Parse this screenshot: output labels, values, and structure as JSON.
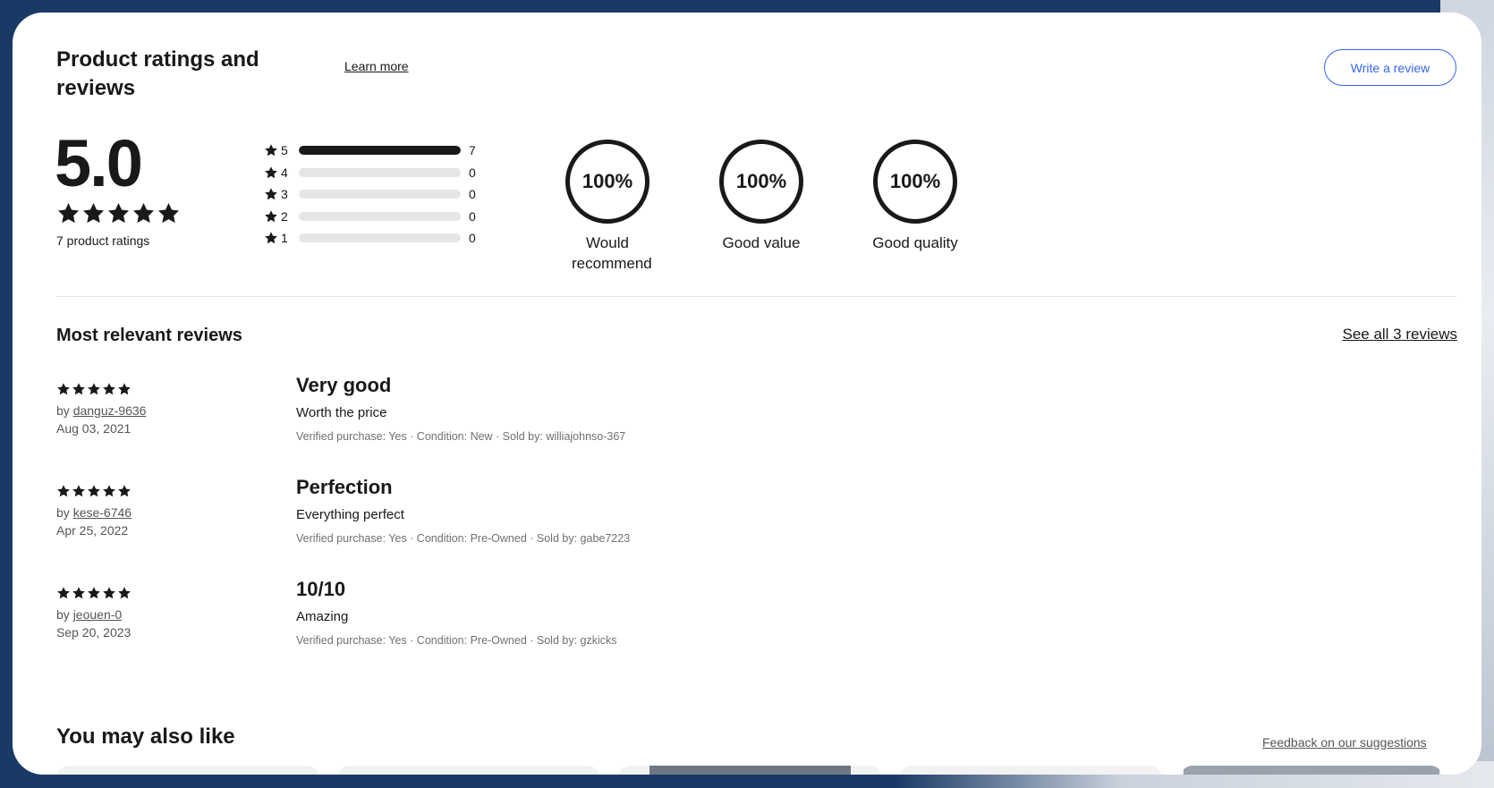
{
  "header": {
    "title": "Product ratings and reviews",
    "learn_more": "Learn more",
    "write_review": "Write a review"
  },
  "summary": {
    "average": "5.0",
    "stars": 5,
    "rating_count": "7 product ratings",
    "histogram": [
      {
        "stars": "5",
        "count": "7",
        "fraction": 1.0
      },
      {
        "stars": "4",
        "count": "0",
        "fraction": 0
      },
      {
        "stars": "3",
        "count": "0",
        "fraction": 0
      },
      {
        "stars": "2",
        "count": "0",
        "fraction": 0
      },
      {
        "stars": "1",
        "count": "0",
        "fraction": 0
      }
    ],
    "aspects": [
      {
        "value": "100%",
        "label": "Would recommend"
      },
      {
        "value": "100%",
        "label": "Good value"
      },
      {
        "value": "100%",
        "label": "Good quality"
      }
    ]
  },
  "reviews_section": {
    "title": "Most relevant reviews",
    "see_all": "See all 3 reviews",
    "by_prefix": "by",
    "items": [
      {
        "stars": 5,
        "author": "danguz-9636",
        "date": "Aug 03, 2021",
        "title": "Very good",
        "body": "Worth the price",
        "meta": "Verified purchase: Yes · Condition: New · Sold by: williajohnso-367"
      },
      {
        "stars": 5,
        "author": "kese-6746",
        "date": "Apr 25, 2022",
        "title": "Perfection",
        "body": "Everything perfect",
        "meta": "Verified purchase: Yes · Condition: Pre-Owned · Sold by: gabe7223"
      },
      {
        "stars": 5,
        "author": "jeouen-0",
        "date": "Sep 20, 2023",
        "title": "10/10",
        "body": "Amazing",
        "meta": "Verified purchase: Yes · Condition: Pre-Owned · Sold by: gzkicks"
      }
    ]
  },
  "also_like": {
    "title": "You may also like",
    "feedback": "Feedback on our suggestions"
  },
  "icons": {
    "star": "star-icon"
  },
  "colors": {
    "accent": "#3665f3",
    "text": "#191919",
    "bar_empty": "#e5e5e5",
    "background": "#1a3a66"
  }
}
